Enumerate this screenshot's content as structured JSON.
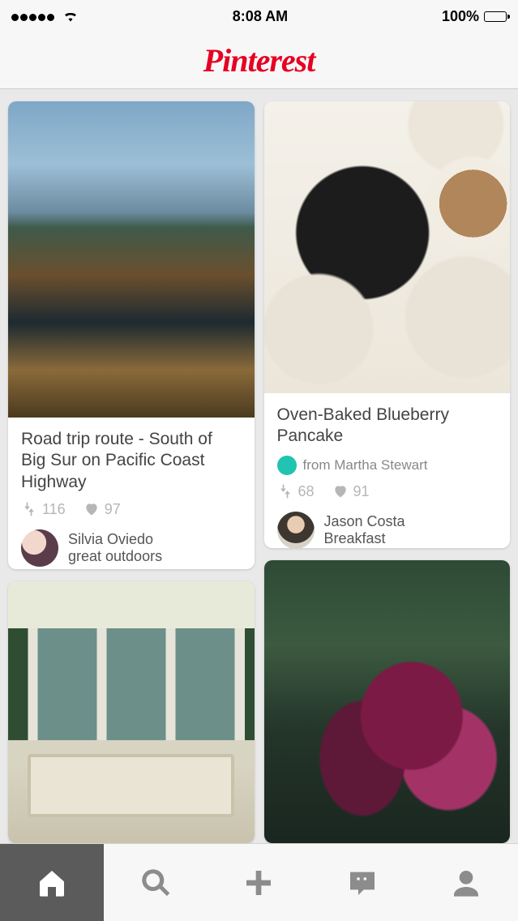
{
  "status": {
    "time": "8:08 AM",
    "battery_pct": "100%"
  },
  "header": {
    "logo_text": "Pinterest"
  },
  "pins": [
    {
      "title": "Road trip route - South of Big Sur on Pacific Coast Highway",
      "repins": "116",
      "likes": "97",
      "user_name": "Silvia Oviedo",
      "user_board": "great outdoors"
    },
    {
      "title": "Oven-Baked Blueberry Pancake",
      "source_prefix": "from ",
      "source": "Martha Stewart",
      "repins": "68",
      "likes": "91",
      "user_name": "Jason Costa",
      "user_board": "Breakfast"
    }
  ],
  "tabbar": {
    "home": "Home",
    "search": "Search",
    "add": "Add",
    "activity": "Activity",
    "profile": "Profile"
  }
}
